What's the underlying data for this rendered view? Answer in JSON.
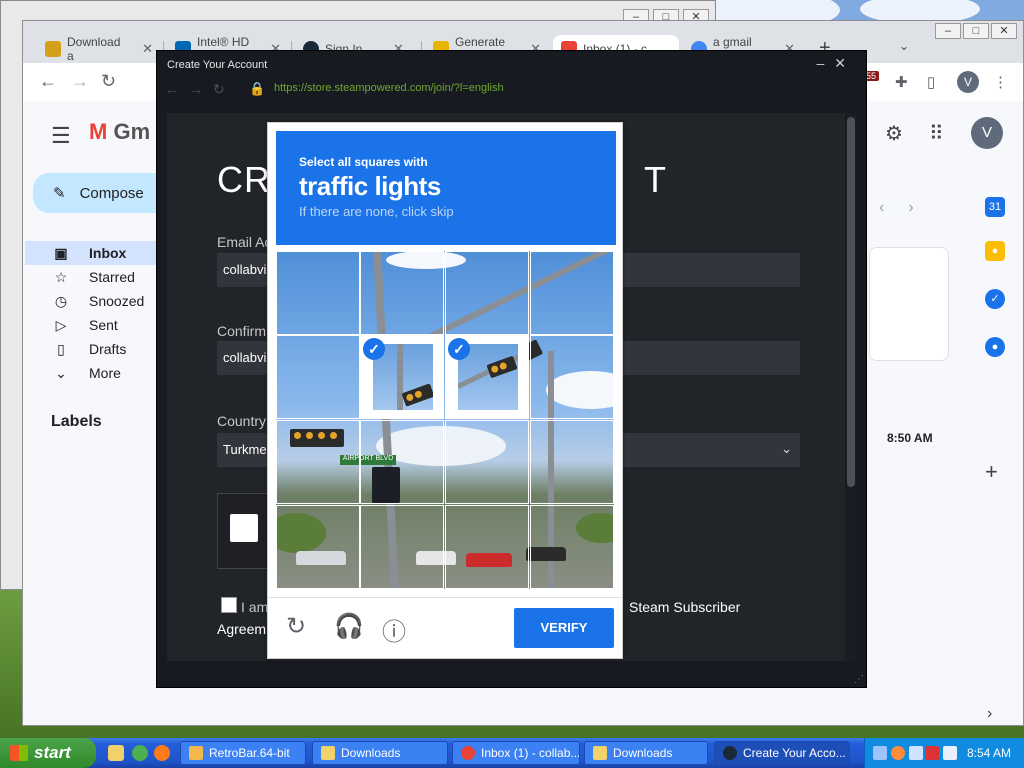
{
  "bg_window": {
    "ctrl_min": "–",
    "ctrl_max": "□",
    "ctrl_close": "✕"
  },
  "browser": {
    "tabs": [
      {
        "label": "Download a",
        "favicon_color": "#d4a017"
      },
      {
        "label": "Intel® HD G",
        "favicon_color": "#0068b5"
      },
      {
        "label": "Sign In",
        "favicon_color": "#1b2838"
      },
      {
        "label": "Generate ra",
        "favicon_color": "#e8b400"
      },
      {
        "label": "Inbox (1) - c",
        "favicon_color": "#ea4335"
      },
      {
        "label": "a gmail sym",
        "favicon_color": "#4285f4"
      }
    ],
    "new_tab": "+",
    "tab_search": "⌄",
    "profile_initial": "V",
    "ext_badge": "55"
  },
  "gmail": {
    "logo_m": "M",
    "logo_text": "Gm",
    "compose": "Compose",
    "nav": [
      {
        "icon": "▣",
        "label": "Inbox",
        "active": true
      },
      {
        "icon": "☆",
        "label": "Starred"
      },
      {
        "icon": "◷",
        "label": "Snoozed"
      },
      {
        "icon": "▷",
        "label": "Sent"
      },
      {
        "icon": "▯",
        "label": "Drafts"
      },
      {
        "icon": "⌄",
        "label": "More"
      }
    ],
    "labels_heading": "Labels",
    "avatar_initial": "V",
    "mail_time": "8:50 AM",
    "side_add": "+"
  },
  "steam": {
    "window_title": "Create Your Account",
    "url": "https://store.steampowered.com/join/?l=english",
    "heading_left": "CRE",
    "heading_right": "T",
    "email_label": "Email Ad",
    "email_value": "collabvi",
    "confirm_label": "Confirm",
    "confirm_value": "collabvi",
    "country_label": "Country",
    "country_value": "Turkme",
    "agree_left": "I am",
    "agree_right": "Steam Subscriber",
    "agree_bottom": "Agreem"
  },
  "captcha": {
    "line1": "Select all squares with",
    "line2": "traffic lights",
    "line3": "If there are none, click skip",
    "street_sign": "AIRPORT BLVD",
    "selected_cells": [
      5,
      6
    ],
    "verify_label": "VERIFY"
  },
  "taskbar": {
    "start_label": "start",
    "tasks": [
      {
        "label": "RetroBar.64-bit",
        "icon_color": "#f2b84b"
      },
      {
        "label": "Downloads",
        "icon_color": "#f2d16b"
      },
      {
        "label": "Inbox (1) - collab...",
        "icon_color": "#ea4335"
      },
      {
        "label": "Downloads",
        "icon_color": "#f2d16b"
      },
      {
        "label": "Create Your Acco...",
        "icon_color": "#1b2838"
      }
    ],
    "clock": "8:54 AM"
  }
}
